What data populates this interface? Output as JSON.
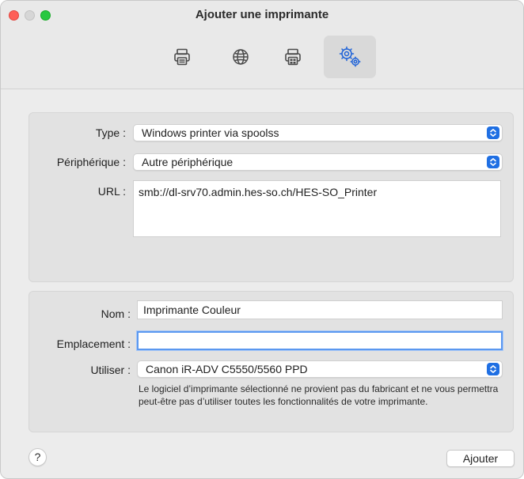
{
  "window": {
    "title": "Ajouter une imprimante"
  },
  "toolbar": {
    "tabs": [
      {
        "icon": "printer-icon",
        "active": false
      },
      {
        "icon": "globe-icon",
        "active": false
      },
      {
        "icon": "windows-printer-icon",
        "active": false
      },
      {
        "icon": "advanced-gears-icon",
        "active": true
      }
    ]
  },
  "connection": {
    "type_label": "Type :",
    "type_value": "Windows printer via spoolss",
    "device_label": "Périphérique :",
    "device_value": "Autre périphérique",
    "url_label": "URL :",
    "url_value": "smb://dl-srv70.admin.hes-so.ch/HES-SO_Printer"
  },
  "details": {
    "name_label": "Nom :",
    "name_value": "Imprimante Couleur",
    "location_label": "Emplacement :",
    "location_value": "",
    "use_label": "Utiliser :",
    "use_value": "Canon iR-ADV C5550/5560 PPD",
    "note": "Le logiciel d’imprimante sélectionné ne provient pas du fabricant et ne vous permettra peut-être pas d’utiliser toutes les fonctionnalités de votre imprimante."
  },
  "footer": {
    "help_label": "?",
    "add_button": "Ajouter"
  },
  "colors": {
    "accent": "#1f6fe3",
    "focus_ring": "#5b98f0",
    "window_bg": "#ececec"
  }
}
